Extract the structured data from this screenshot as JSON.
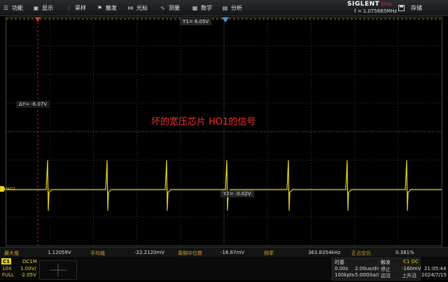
{
  "menu": {
    "items": [
      {
        "label": "功能",
        "icon": "menu-icon"
      },
      {
        "label": "显示",
        "icon": "display-icon"
      },
      {
        "label": "采样",
        "icon": "acquire-icon"
      },
      {
        "label": "触发",
        "icon": "trigger-icon"
      },
      {
        "label": "光标",
        "icon": "cursor-icon"
      },
      {
        "label": "测量",
        "icon": "measure-icon"
      },
      {
        "label": "数学",
        "icon": "math-icon"
      },
      {
        "label": "分析",
        "icon": "analysis-icon"
      }
    ]
  },
  "header": {
    "brand": "SIGLENT",
    "status": "Stop",
    "frequency": "f = 1.075665MHz",
    "save_label": "存储"
  },
  "screen": {
    "y1_label": "Y1= 6.05V",
    "delta_y_label": "ΔY= -6.07V",
    "y2_label": "Y2= -0.02V",
    "channel_marker": "HO1",
    "annotation": "坏的宽压芯片 HO1的信号",
    "colors": {
      "trace": "#e8d21a",
      "cursor": "#e03030",
      "annotation": "#ff2b2b"
    }
  },
  "measurements": [
    {
      "label": "最大值",
      "value": "1.12059V"
    },
    {
      "label": "平均值",
      "value": "-22.2120mV"
    },
    {
      "label": "周期中位数",
      "value": "-16.67mV"
    },
    {
      "label": "频率",
      "value": "363.8354kHz"
    },
    {
      "label": "正占空比",
      "value": "0.381%"
    }
  ],
  "channel": {
    "name": "C1",
    "coupling": "DC1M",
    "probe": "10X",
    "scale": "1.00V/",
    "bandwidth": "FULL",
    "offset": "-2.05V"
  },
  "timebase": {
    "title": "时基",
    "delay": "0.00s",
    "scale": "2.00us/div",
    "memory": "100kpts",
    "rate": "5.00GSa/s"
  },
  "trigger": {
    "title": "触发",
    "source": "C1 DC",
    "state": "停止",
    "level": "-160mV",
    "mode": "边沿",
    "slope": "上升沿"
  },
  "clock": {
    "time": "21:05:44",
    "date": "2024/7/15"
  }
}
